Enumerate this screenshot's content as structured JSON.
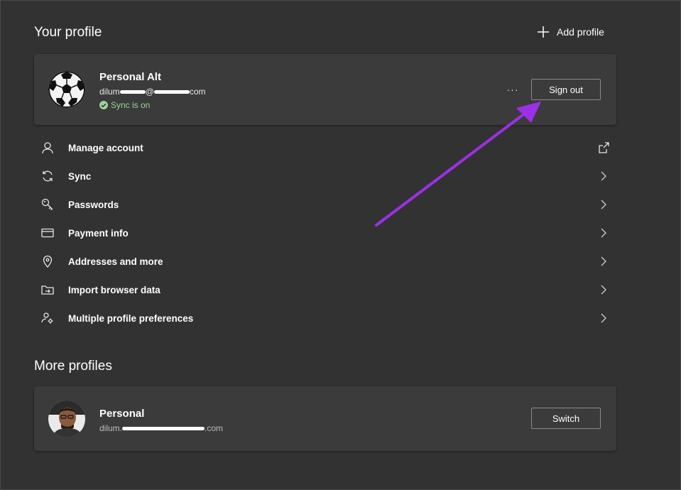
{
  "your_profile": {
    "title": "Your profile",
    "add_profile_label": "Add profile",
    "current": {
      "name": "Personal Alt",
      "email_prefix": "dilum",
      "email_at": "@",
      "email_suffix": "com",
      "sync_status": "Sync is on",
      "more_label": "···",
      "sign_out_label": "Sign out"
    }
  },
  "menu": [
    {
      "label": "Manage account",
      "icon": "person-icon",
      "trailing": "open-external-icon"
    },
    {
      "label": "Sync",
      "icon": "sync-icon",
      "trailing": "chevron-right-icon"
    },
    {
      "label": "Passwords",
      "icon": "key-icon",
      "trailing": "chevron-right-icon"
    },
    {
      "label": "Payment info",
      "icon": "credit-card-icon",
      "trailing": "chevron-right-icon"
    },
    {
      "label": "Addresses and more",
      "icon": "location-pin-icon",
      "trailing": "chevron-right-icon"
    },
    {
      "label": "Import browser data",
      "icon": "import-folder-icon",
      "trailing": "chevron-right-icon"
    },
    {
      "label": "Multiple profile preferences",
      "icon": "profiles-settings-icon",
      "trailing": "chevron-right-icon"
    }
  ],
  "more_profiles": {
    "title": "More profiles",
    "profile": {
      "name": "Personal",
      "email_prefix": "dilum.",
      "email_suffix": ".com",
      "switch_label": "Switch"
    }
  },
  "colors": {
    "background": "#323232",
    "card": "#3b3b3b",
    "sync_green": "#9ed29a",
    "annotation_arrow": "#9b30e6"
  }
}
